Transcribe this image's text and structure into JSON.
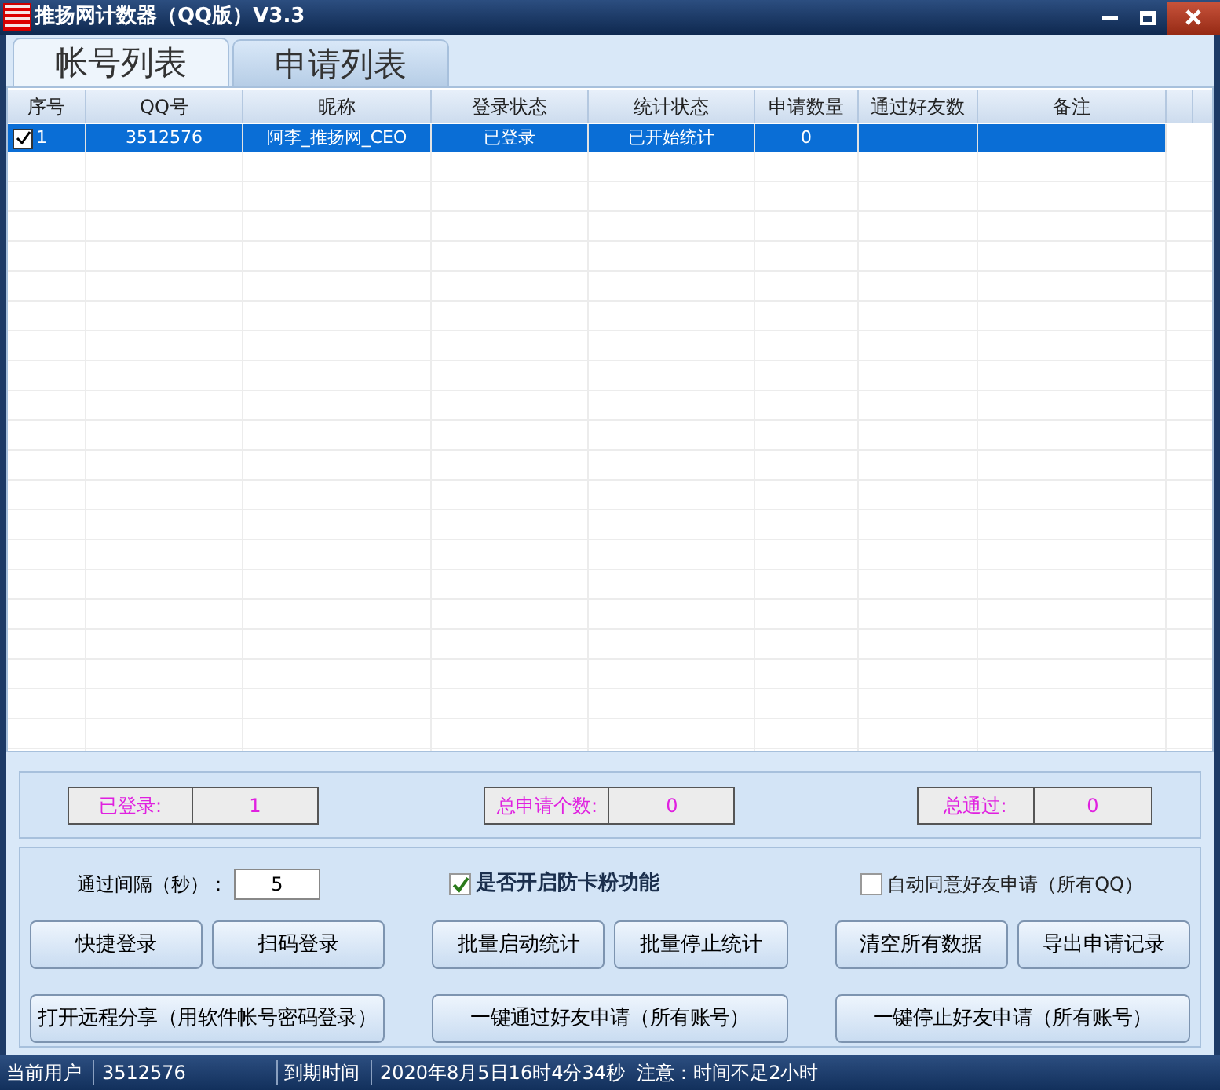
{
  "window": {
    "title": "推扬网计数器（QQ版）V3.3"
  },
  "tabs": [
    {
      "label": "帐号列表",
      "selected": true
    },
    {
      "label": "申请列表",
      "selected": false
    }
  ],
  "table": {
    "columns": [
      "序号",
      "QQ号",
      "昵称",
      "登录状态",
      "统计状态",
      "申请数量",
      "通过好友数",
      "备注"
    ],
    "rows": [
      {
        "checked": true,
        "selected": true,
        "cells": [
          "1",
          "3512576",
          "阿李_推扬网_CEO",
          "已登录",
          "已开始统计",
          "0",
          "",
          ""
        ]
      }
    ]
  },
  "stats": [
    {
      "label": "已登录:",
      "value": "1"
    },
    {
      "label": "总申请个数:",
      "value": "0"
    },
    {
      "label": "总通过:",
      "value": "0"
    }
  ],
  "interval": {
    "label": "通过间隔（秒）：",
    "value": "5"
  },
  "options": [
    {
      "label": "是否开启防卡粉功能",
      "checked": true
    },
    {
      "label": "自动同意好友申请（所有QQ）",
      "checked": false
    }
  ],
  "buttons": [
    [
      "快捷登录",
      "扫码登录"
    ],
    [
      "批量启动统计",
      "批量停止统计"
    ],
    [
      "清空所有数据",
      "导出申请记录"
    ]
  ],
  "wide_buttons": [
    "打开远程分享（用软件帐号密码登录）",
    "一键通过好友申请（所有账号）",
    "一键停止好友申请（所有账号）"
  ],
  "status_bar": [
    {
      "label": "当前用户",
      "value": "3512576"
    },
    {
      "label": "到期时间",
      "value": "2020年8月5日16时4分34秒  注意：时间不足2小时"
    }
  ]
}
